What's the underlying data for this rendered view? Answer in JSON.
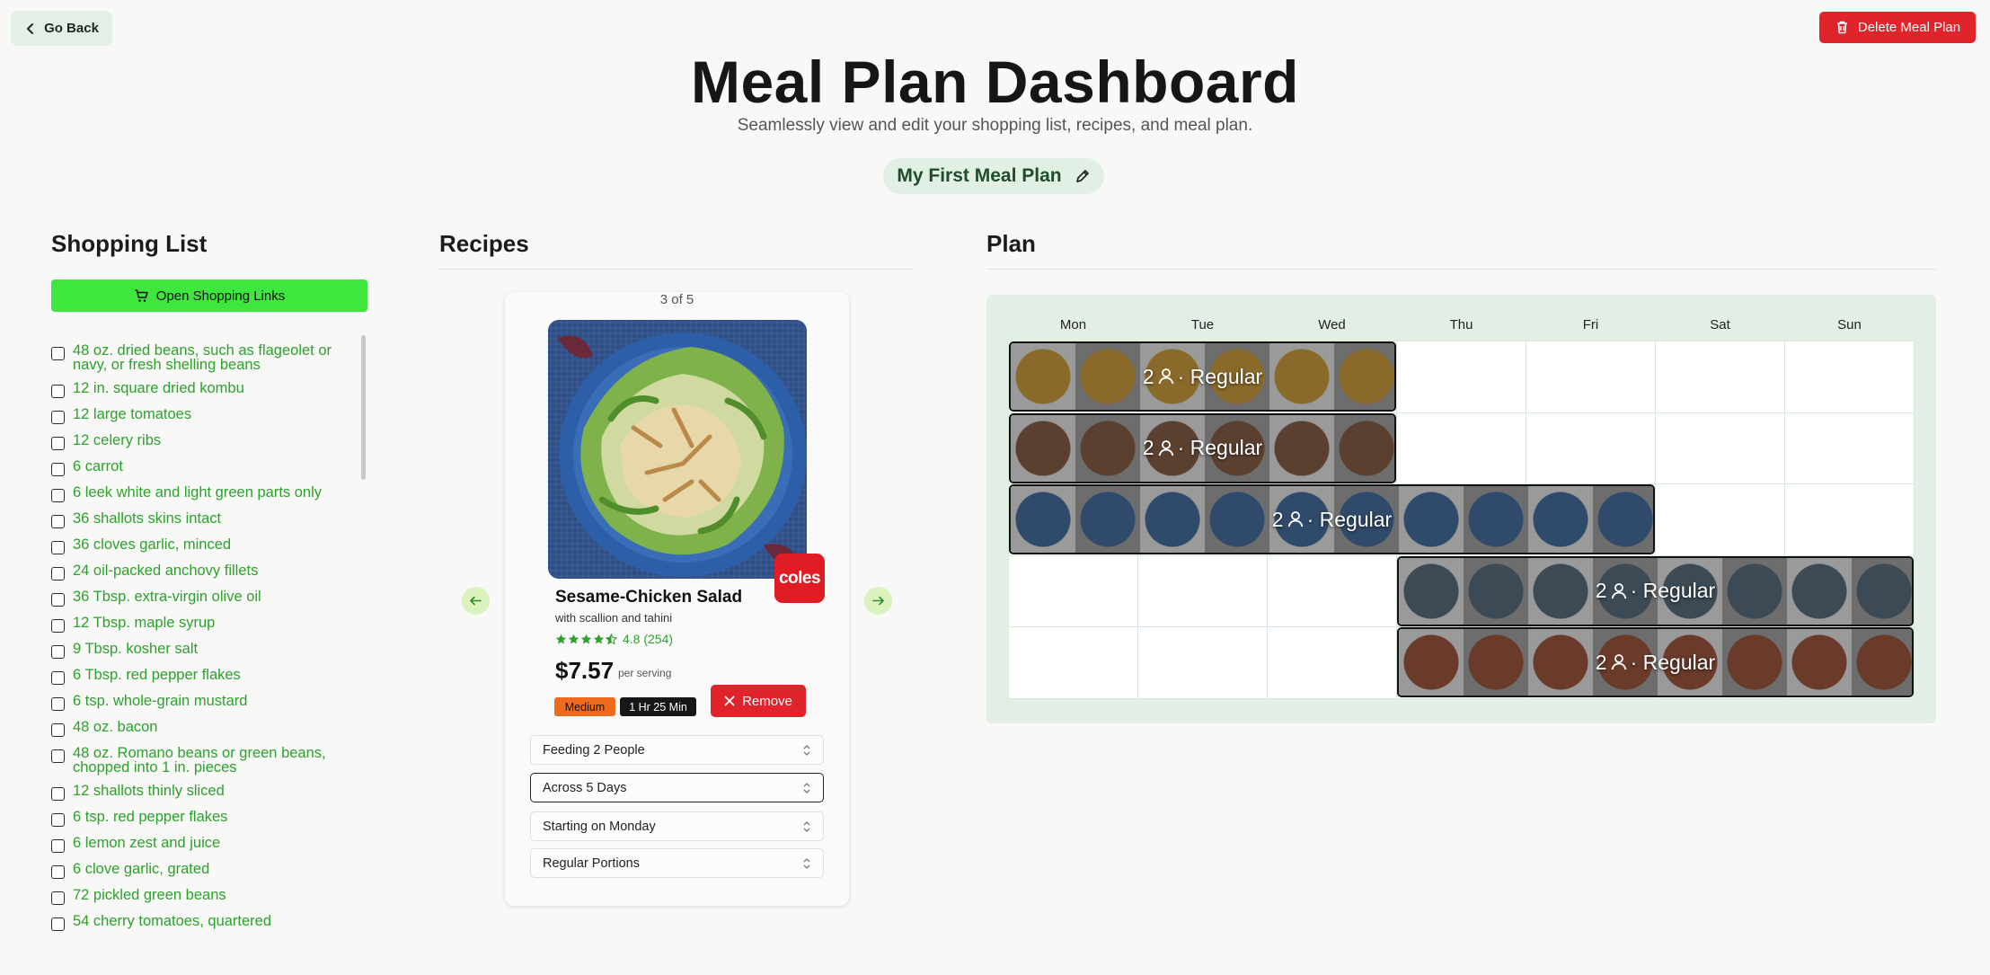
{
  "header": {
    "go_back_label": "Go Back",
    "delete_label": "Delete Meal Plan",
    "title": "Meal Plan Dashboard",
    "subtitle": "Seamlessly view and edit your shopping list, recipes, and meal plan.",
    "plan_name": "My First Meal Plan"
  },
  "shopping": {
    "title": "Shopping List",
    "open_links_label": "Open Shopping Links",
    "items": [
      "48 oz. dried beans, such as flageolet or navy, or fresh shelling beans",
      "12 in. square dried kombu",
      "12 large tomatoes",
      "12 celery ribs",
      "6 carrot",
      "6 leek white and light green parts only",
      "36 shallots skins intact",
      "36 cloves garlic, minced",
      "24 oil-packed anchovy fillets",
      "36 Tbsp. extra-virgin olive oil",
      "12 Tbsp. maple syrup",
      "9 Tbsp. kosher salt",
      "6 Tbsp. red pepper flakes",
      "6 tsp. whole-grain mustard",
      "48 oz. bacon",
      "48 oz. Romano beans or green beans, chopped into 1 in. pieces",
      "12 shallots thinly sliced",
      "6 tsp. red pepper flakes",
      "6 lemon zest and juice",
      "6 clove garlic, grated",
      "72 pickled green beans",
      "54 cherry tomatoes, quartered"
    ]
  },
  "recipes": {
    "title": "Recipes",
    "counter": "3 of 5",
    "store_badge": "coles",
    "name": "Sesame-Chicken Salad",
    "subtitle": "with scallion and tahini",
    "rating": "4.8 (254)",
    "rating_value": 4.8,
    "price": "$7.57",
    "per_serving": "per serving",
    "difficulty": "Medium",
    "time": "1 Hr 25 Min",
    "remove_label": "Remove",
    "selects": [
      "Feeding 2 People",
      "Across 5 Days",
      "Starting on Monday",
      "Regular Portions"
    ]
  },
  "plan": {
    "title": "Plan",
    "days": [
      "Mon",
      "Tue",
      "Wed",
      "Thu",
      "Fri",
      "Sat",
      "Sun"
    ],
    "meals": [
      {
        "label_count": "2",
        "label_portion": "· Regular",
        "start_day": "Mon",
        "end_day": "Wed",
        "color": "#8a6a2a"
      },
      {
        "label_count": "2",
        "label_portion": "· Regular",
        "start_day": "Mon",
        "end_day": "Wed",
        "color": "#5b4030"
      },
      {
        "label_count": "2",
        "label_portion": "· Regular",
        "start_day": "Mon",
        "end_day": "Fri",
        "color": "#2f4a6a"
      },
      {
        "label_count": "2",
        "label_portion": "· Regular",
        "start_day": "Thu",
        "end_day": "Sun",
        "color": "#3b4a55"
      },
      {
        "label_count": "2",
        "label_portion": "· Regular",
        "start_day": "Thu",
        "end_day": "Sun",
        "color": "#6a3a2a"
      }
    ]
  },
  "colors": {
    "accent_green": "#3ee63e",
    "danger_red": "#e0242b",
    "list_text_green": "#2ca12c",
    "plan_bg": "#e3efe4"
  }
}
